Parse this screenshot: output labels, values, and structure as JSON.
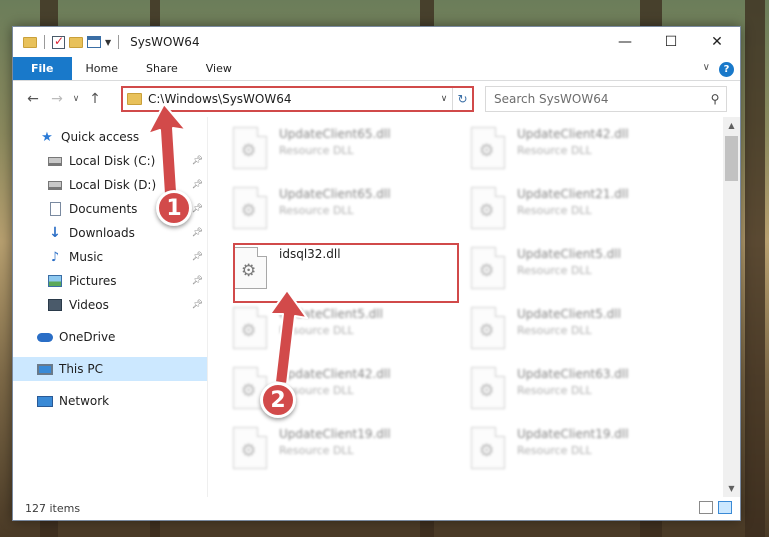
{
  "window": {
    "title": "SysWOW64",
    "controls": {
      "minimize": "—",
      "maximize": "☐",
      "close": "✕"
    }
  },
  "ribbon": {
    "tabs": [
      "File",
      "Home",
      "Share",
      "View"
    ],
    "help": "?"
  },
  "address_bar": {
    "path": "C:\\Windows\\SysWOW64",
    "refresh_icon": "refresh-icon"
  },
  "search": {
    "placeholder": "Search SysWOW64"
  },
  "sidebar": {
    "quick_access": "Quick access",
    "pinned": [
      {
        "label": "Local Disk (C:)",
        "icon": "disk-icon"
      },
      {
        "label": "Local Disk (D:)",
        "icon": "disk-icon"
      },
      {
        "label": "Documents",
        "icon": "documents-icon"
      },
      {
        "label": "Downloads",
        "icon": "downloads-icon"
      },
      {
        "label": "Music",
        "icon": "music-icon"
      },
      {
        "label": "Pictures",
        "icon": "pictures-icon"
      },
      {
        "label": "Videos",
        "icon": "videos-icon"
      }
    ],
    "onedrive": "OneDrive",
    "this_pc": "This PC",
    "network": "Network"
  },
  "files": [
    {
      "name": "UpdateClient65.dll",
      "type": "Resource DLL",
      "blurred": true
    },
    {
      "name": "UpdateClient42.dll",
      "type": "Resource DLL",
      "blurred": true
    },
    {
      "name": "UpdateClient65.dll",
      "type": "Resource DLL",
      "blurred": true
    },
    {
      "name": "UpdateClient21.dll",
      "type": "Resource DLL",
      "blurred": true
    },
    {
      "name": "idsql32.dll",
      "type": "",
      "blurred": false
    },
    {
      "name": "UpdateClient5.dll",
      "type": "Resource DLL",
      "blurred": true
    },
    {
      "name": "UpdateClient5.dll",
      "type": "Resource DLL",
      "blurred": true
    },
    {
      "name": "UpdateClient5.dll",
      "type": "Resource DLL",
      "blurred": true
    },
    {
      "name": "UpdateClient42.dll",
      "type": "Resource DLL",
      "blurred": true
    },
    {
      "name": "UpdateClient63.dll",
      "type": "Resource DLL",
      "blurred": true
    },
    {
      "name": "UpdateClient19.dll",
      "type": "Resource DLL",
      "blurred": true
    },
    {
      "name": "UpdateClient19.dll",
      "type": "Resource DLL",
      "blurred": true
    }
  ],
  "status": {
    "item_count": "127 items"
  },
  "callouts": [
    "1",
    "2"
  ],
  "colors": {
    "accent": "#1979ca",
    "highlight": "#d14a4a",
    "selection": "#cce8ff"
  }
}
